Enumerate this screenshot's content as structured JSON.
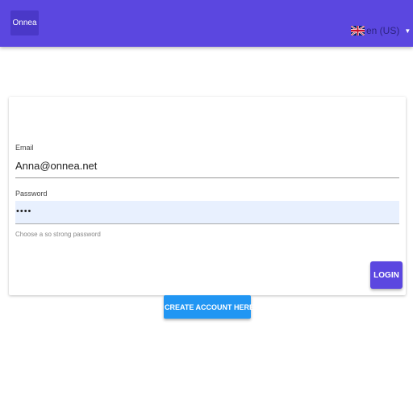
{
  "header": {
    "brand": "Onnea",
    "language": {
      "label": "en (US)",
      "flag_icon": "uk-flag-icon",
      "caret_icon": "caret-down-icon"
    }
  },
  "login_form": {
    "email": {
      "label": "Email",
      "value": "Anna@onnea.net"
    },
    "password": {
      "label": "Password",
      "value": "••••",
      "hint": "Choose a so strong password"
    },
    "login_button": "LOGIN"
  },
  "create_account": {
    "label": "CREATE ACCOUNT HERE",
    "icon": "contact-card-icon"
  },
  "colors": {
    "primary": "#5b47e0",
    "secondary": "#2196f3",
    "autofill_background": "#e8f0fe"
  }
}
